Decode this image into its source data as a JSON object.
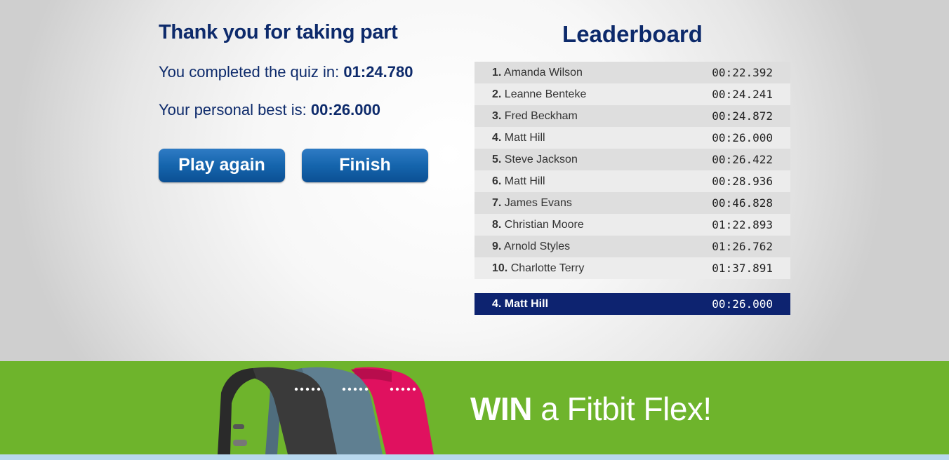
{
  "result": {
    "thanks": "Thank you for taking part",
    "completed_label": "You completed the quiz in:",
    "completed_time": "01:24.780",
    "best_label": "Your personal best is:",
    "best_time": "00:26.000"
  },
  "buttons": {
    "play_again": "Play again",
    "finish": "Finish"
  },
  "leaderboard": {
    "title": "Leaderboard",
    "rows": [
      {
        "rank": "1.",
        "name": "Amanda Wilson",
        "time": "00:22.392"
      },
      {
        "rank": "2.",
        "name": "Leanne Benteke",
        "time": "00:24.241"
      },
      {
        "rank": "3.",
        "name": "Fred Beckham",
        "time": "00:24.872"
      },
      {
        "rank": "4.",
        "name": "Matt Hill",
        "time": "00:26.000"
      },
      {
        "rank": "5.",
        "name": "Steve Jackson",
        "time": "00:26.422"
      },
      {
        "rank": "6.",
        "name": "Matt Hill",
        "time": "00:28.936"
      },
      {
        "rank": "7.",
        "name": "James Evans",
        "time": "00:46.828"
      },
      {
        "rank": "8.",
        "name": "Christian Moore",
        "time": "01:22.893"
      },
      {
        "rank": "9.",
        "name": "Arnold Styles",
        "time": "01:26.762"
      },
      {
        "rank": "10.",
        "name": "Charlotte Terry",
        "time": "01:37.891"
      }
    ],
    "current": {
      "rank": "4.",
      "name": "Matt Hill",
      "time": "00:26.000"
    }
  },
  "banner": {
    "win": "WIN",
    "text": "a Fitbit Flex!",
    "band_colors": [
      "#3a3a3a",
      "#5f7f91",
      "#e0115f"
    ],
    "background": "#6eb42c"
  }
}
